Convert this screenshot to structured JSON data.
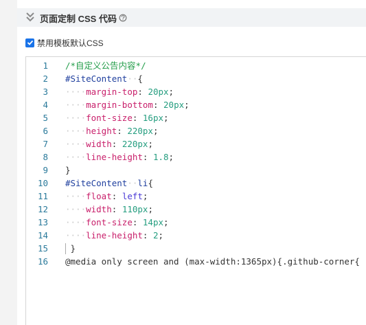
{
  "section": {
    "title": "页面定制 CSS 代码",
    "chevron_icon": "double-chevron-down-icon",
    "help_icon": "help-circle-icon"
  },
  "option": {
    "label": "禁用模板默认CSS",
    "checked": true,
    "color": "#1a73e8"
  },
  "editor": {
    "line_numbers": [
      "1",
      "2",
      "3",
      "4",
      "5",
      "6",
      "7",
      "8",
      "9",
      "10",
      "11",
      "12",
      "13",
      "14",
      "15",
      "16"
    ],
    "lines": [
      [
        {
          "t": "cm",
          "v": "/*自定义公告内容*/"
        }
      ],
      [
        {
          "t": "sel",
          "v": "#SiteContent"
        },
        {
          "t": "guide",
          "v": "··"
        },
        {
          "t": "plain",
          "v": "{"
        }
      ],
      [
        {
          "t": "guide",
          "v": "····"
        },
        {
          "t": "prop",
          "v": "margin-top"
        },
        {
          "t": "plain",
          "v": ": "
        },
        {
          "t": "num",
          "v": "20px"
        },
        {
          "t": "plain",
          "v": ";"
        }
      ],
      [
        {
          "t": "guide",
          "v": "····"
        },
        {
          "t": "prop",
          "v": "margin-bottom"
        },
        {
          "t": "plain",
          "v": ": "
        },
        {
          "t": "num",
          "v": "20px"
        },
        {
          "t": "plain",
          "v": ";"
        }
      ],
      [
        {
          "t": "guide",
          "v": "····"
        },
        {
          "t": "prop",
          "v": "font-size"
        },
        {
          "t": "plain",
          "v": ": "
        },
        {
          "t": "num",
          "v": "16px"
        },
        {
          "t": "plain",
          "v": ";"
        }
      ],
      [
        {
          "t": "guide",
          "v": "····"
        },
        {
          "t": "prop",
          "v": "height"
        },
        {
          "t": "plain",
          "v": ": "
        },
        {
          "t": "num",
          "v": "220px"
        },
        {
          "t": "plain",
          "v": ";"
        }
      ],
      [
        {
          "t": "guide",
          "v": "····"
        },
        {
          "t": "prop",
          "v": "width"
        },
        {
          "t": "plain",
          "v": ": "
        },
        {
          "t": "num",
          "v": "220px"
        },
        {
          "t": "plain",
          "v": ";"
        }
      ],
      [
        {
          "t": "guide",
          "v": "····"
        },
        {
          "t": "prop",
          "v": "line-height"
        },
        {
          "t": "plain",
          "v": ": "
        },
        {
          "t": "num",
          "v": "1.8"
        },
        {
          "t": "plain",
          "v": ";"
        }
      ],
      [
        {
          "t": "plain",
          "v": "}"
        }
      ],
      [
        {
          "t": "sel",
          "v": "#SiteContent"
        },
        {
          "t": "guide",
          "v": "··"
        },
        {
          "t": "sel",
          "v": "li"
        },
        {
          "t": "plain",
          "v": "{"
        }
      ],
      [
        {
          "t": "guide",
          "v": "····"
        },
        {
          "t": "prop",
          "v": "float"
        },
        {
          "t": "plain",
          "v": ": "
        },
        {
          "t": "val",
          "v": "left"
        },
        {
          "t": "plain",
          "v": ";"
        }
      ],
      [
        {
          "t": "guide",
          "v": "····"
        },
        {
          "t": "prop",
          "v": "width"
        },
        {
          "t": "plain",
          "v": ": "
        },
        {
          "t": "num",
          "v": "110px"
        },
        {
          "t": "plain",
          "v": ";"
        }
      ],
      [
        {
          "t": "guide",
          "v": "····"
        },
        {
          "t": "prop",
          "v": "font-size"
        },
        {
          "t": "plain",
          "v": ": "
        },
        {
          "t": "num",
          "v": "14px"
        },
        {
          "t": "plain",
          "v": ";"
        }
      ],
      [
        {
          "t": "guide",
          "v": "····"
        },
        {
          "t": "prop",
          "v": "line-height"
        },
        {
          "t": "plain",
          "v": ": "
        },
        {
          "t": "num",
          "v": "2"
        },
        {
          "t": "plain",
          "v": ";"
        }
      ],
      [
        {
          "t": "guide",
          "v": " "
        },
        {
          "t": "plain",
          "v": "}"
        }
      ],
      [
        {
          "t": "plain",
          "v": "@media only screen and (max-width:1365px){.github-corner{"
        }
      ]
    ]
  }
}
